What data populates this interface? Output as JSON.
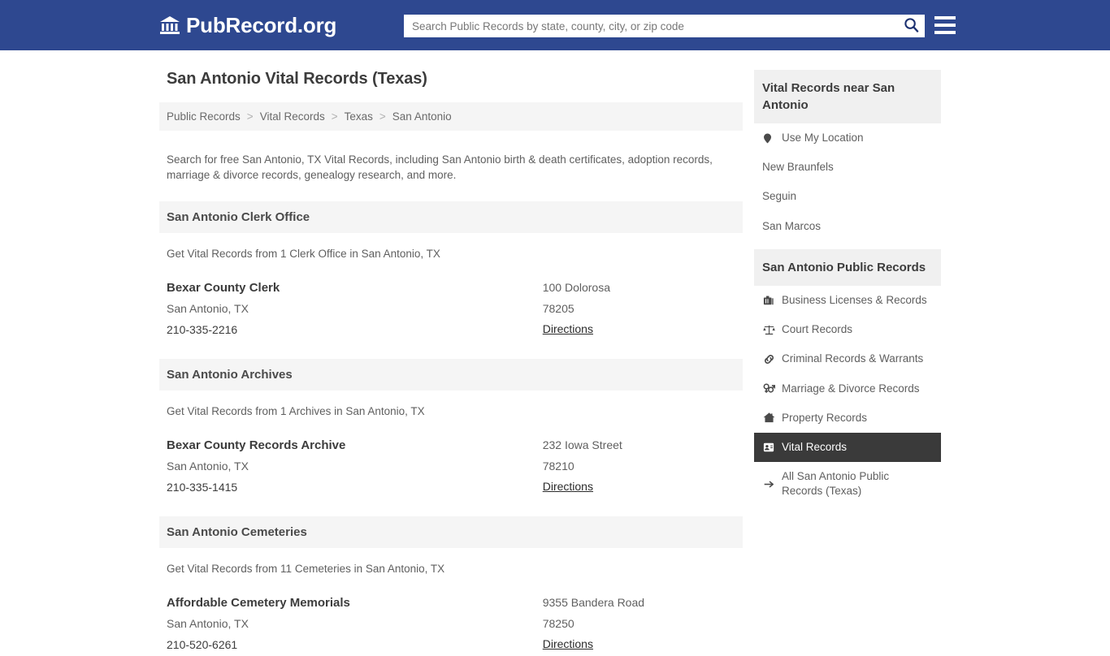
{
  "header": {
    "logo_icon": "bank-building-icon",
    "logo_text": "PubRecord.org",
    "search_placeholder": "Search Public Records by state, county, city, or zip code",
    "search_value": "",
    "search_icon": "search-icon",
    "menu_icon": "hamburger-menu-icon",
    "background_color": "#2e4890"
  },
  "page": {
    "title": "San Antonio Vital Records (Texas)",
    "intro": "Search for free San Antonio, TX Vital Records, including San Antonio birth & death certificates, adoption records, marriage & divorce records, genealogy research, and more."
  },
  "breadcrumb": {
    "separator": ">",
    "items": [
      {
        "label": "Public Records"
      },
      {
        "label": "Vital Records"
      },
      {
        "label": "Texas"
      },
      {
        "label": "San Antonio"
      }
    ]
  },
  "sections": [
    {
      "header": "San Antonio Clerk Office",
      "subtitle": "Get Vital Records from 1 Clerk Office in San Antonio, TX",
      "listing": {
        "name": "Bexar County Clerk",
        "city_state": "San Antonio, TX",
        "phone": "210-335-2216",
        "address": "100 Dolorosa",
        "zip": "78205",
        "directions_label": "Directions"
      }
    },
    {
      "header": "San Antonio Archives",
      "subtitle": "Get Vital Records from 1 Archives in San Antonio, TX",
      "listing": {
        "name": "Bexar County Records Archive",
        "city_state": "San Antonio, TX",
        "phone": "210-335-1415",
        "address": "232 Iowa Street",
        "zip": "78210",
        "directions_label": "Directions"
      }
    },
    {
      "header": "San Antonio Cemeteries",
      "subtitle": "Get Vital Records from 11 Cemeteries in San Antonio, TX",
      "listing": {
        "name": "Affordable Cemetery Memorials",
        "city_state": "San Antonio, TX",
        "phone": "210-520-6261",
        "address": "9355 Bandera Road",
        "zip": "78250",
        "directions_label": "Directions"
      }
    }
  ],
  "sidebar": {
    "nearby": {
      "header": "Vital Records near San Antonio",
      "items": [
        {
          "label": "Use My Location",
          "icon": "map-pin-icon"
        },
        {
          "label": "New Braunfels",
          "icon": ""
        },
        {
          "label": "Seguin",
          "icon": ""
        },
        {
          "label": "San Marcos",
          "icon": ""
        }
      ]
    },
    "public_records": {
      "header": "San Antonio Public Records",
      "active_background_color": "#3a3a3a",
      "items": [
        {
          "label": "Business Licenses & Records",
          "icon": "briefcase-icon",
          "active": false
        },
        {
          "label": "Court Records",
          "icon": "scales-icon",
          "active": false
        },
        {
          "label": "Criminal Records & Warrants",
          "icon": "link-chain-icon",
          "active": false
        },
        {
          "label": "Marriage & Divorce Records",
          "icon": "venus-mars-icon",
          "active": false
        },
        {
          "label": "Property Records",
          "icon": "house-icon",
          "active": false
        },
        {
          "label": "Vital Records",
          "icon": "address-card-icon",
          "active": true
        },
        {
          "label": "All San Antonio Public Records (Texas)",
          "icon": "arrow-right-icon",
          "active": false
        }
      ]
    }
  }
}
